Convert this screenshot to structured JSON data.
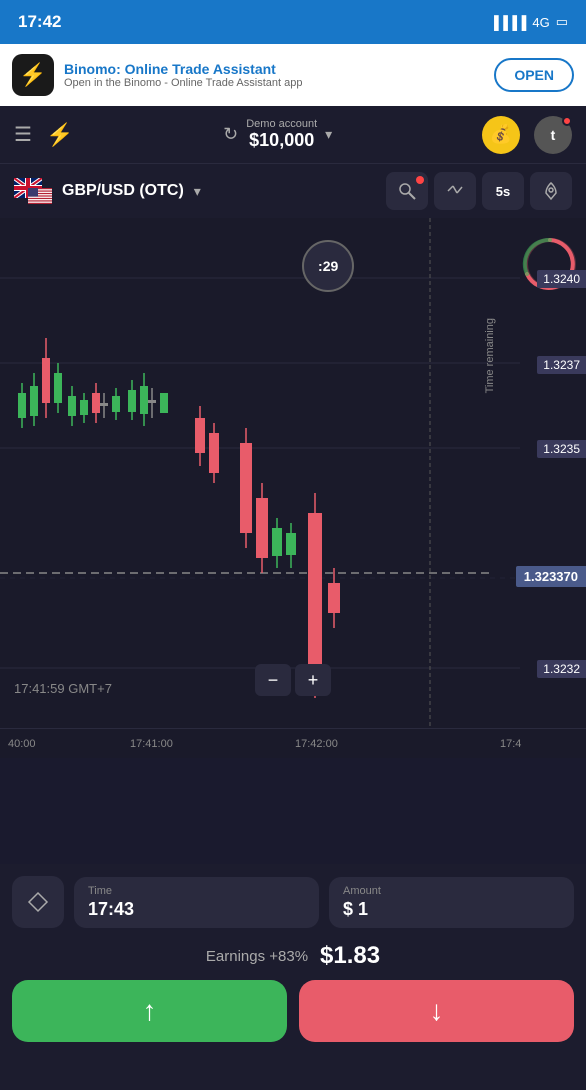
{
  "statusBar": {
    "time": "17:42",
    "signal": "4G",
    "battery": "battery"
  },
  "appBanner": {
    "title": "Binomo: Online Trade Assistant",
    "subtitle": "Open in the Binomo - Online Trade Assistant app",
    "openLabel": "OPEN",
    "iconChar": "⚡"
  },
  "navBar": {
    "accountLabel": "Demo account",
    "accountValue": "$10,000",
    "walletIcon": "👛",
    "avatarLetter": "t",
    "refreshIcon": "↻"
  },
  "instrument": {
    "name": "GBP/USD (OTC)",
    "tools": [
      "✏️",
      "⇅",
      "5s",
      "🚀"
    ]
  },
  "chart": {
    "prices": {
      "p1": "1.3240",
      "p2": "1.3237",
      "p3": "1.3235",
      "current": "1.323370",
      "p5": "1.3232"
    },
    "timeAxis": [
      "40:00",
      "17:41:00",
      "17:42:00",
      "17:4"
    ],
    "currentTime": "17:41:59 GMT+7",
    "timerValue": ":29",
    "timeRemainingLabel": "Time remaining"
  },
  "tradePanel": {
    "diamondIcon": "◇",
    "timeLabel": "Time",
    "timeValue": "17:43",
    "amountLabel": "Amount",
    "amountValue": "$ 1",
    "earningsLabel": "Earnings +83%",
    "earningsValue": "$1.83",
    "upLabel": "UP",
    "downLabel": "DOWN"
  }
}
